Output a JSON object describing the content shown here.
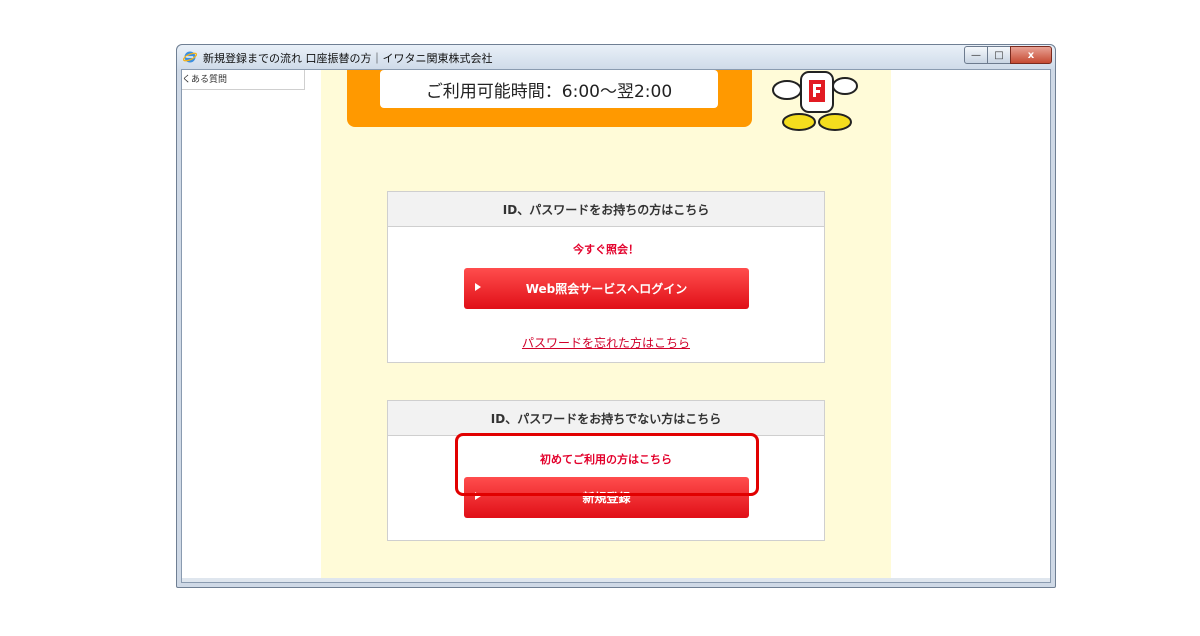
{
  "window": {
    "title": "新規登録までの流れ 口座振替の方｜イワタニ関東株式会社",
    "min_glyph": "—",
    "max_glyph": "□",
    "close_glyph": "x"
  },
  "sidebar": {
    "faq_label": "くある質問"
  },
  "hours": {
    "text": "ご利用可能時間：6:00〜翌2:00"
  },
  "login_panel": {
    "heading": "ID、パスワードをお持ちの方はこちら",
    "lead": "今すぐ照会！",
    "button_label": "Web照会サービスへログイン",
    "forgot_link": "パスワードを忘れた方はこちら"
  },
  "register_panel": {
    "heading": "ID、パスワードをお持ちでない方はこちら",
    "lead": "初めてご利用の方はこちら",
    "button_label": "新規登録"
  },
  "colors": {
    "accent_orange": "#ff9900",
    "button_red": "#e00f17",
    "text_red": "#e3002b",
    "page_bg": "#fffbd8"
  }
}
